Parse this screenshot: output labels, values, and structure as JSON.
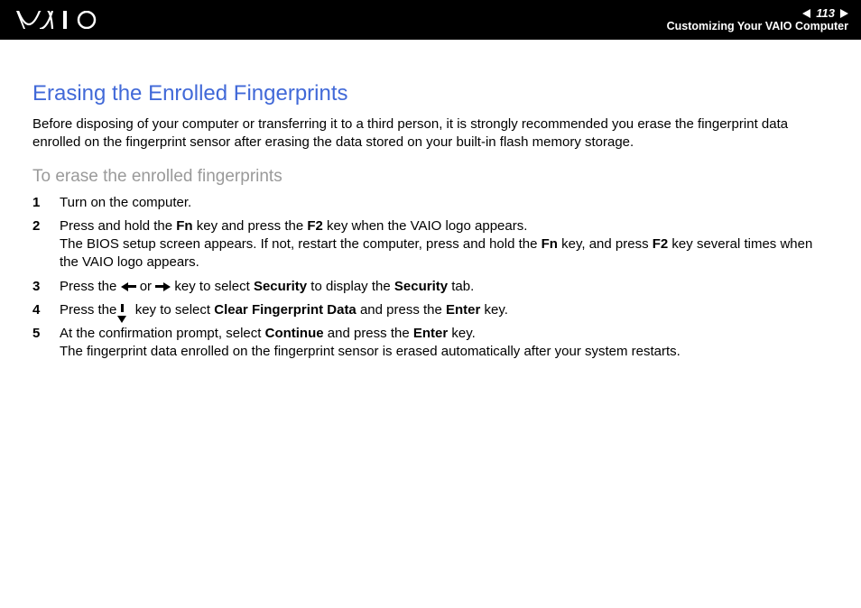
{
  "header": {
    "page_number": "113",
    "section_label": "Customizing Your VAIO Computer"
  },
  "main": {
    "title": "Erasing the Enrolled Fingerprints",
    "intro": "Before disposing of your computer or transferring it to a third person, it is strongly recommended you erase the fingerprint data enrolled on the fingerprint sensor after erasing the data stored on your built-in flash memory storage.",
    "subhead": "To erase the enrolled fingerprints",
    "steps": [
      {
        "num": "1",
        "text": "Turn on the computer."
      },
      {
        "num": "2",
        "pre1": "Press and hold the ",
        "b1": "Fn",
        "mid1": " key and press the ",
        "b2": "F2",
        "post1": " key when the VAIO logo appears.",
        "line2a": "The BIOS setup screen appears. If not, restart the computer, press and hold the ",
        "b3": "Fn",
        "line2b": " key, and press ",
        "b4": "F2",
        "line2c": " key several times when the VAIO logo appears."
      },
      {
        "num": "3",
        "pre": "Press the ",
        "mid": " or ",
        "post1": " key to select ",
        "b1": "Security",
        "post2": " to display the ",
        "b2": "Security",
        "post3": " tab."
      },
      {
        "num": "4",
        "pre": "Press the ",
        "post1": " key to select ",
        "b1": "Clear Fingerprint Data",
        "post2": " and press the ",
        "b2": "Enter",
        "post3": " key."
      },
      {
        "num": "5",
        "pre": "At the confirmation prompt, select ",
        "b1": "Continue",
        "mid": " and press the ",
        "b2": "Enter",
        "post": " key.",
        "line2": "The fingerprint data enrolled on the fingerprint sensor is erased automatically after your system restarts."
      }
    ]
  }
}
